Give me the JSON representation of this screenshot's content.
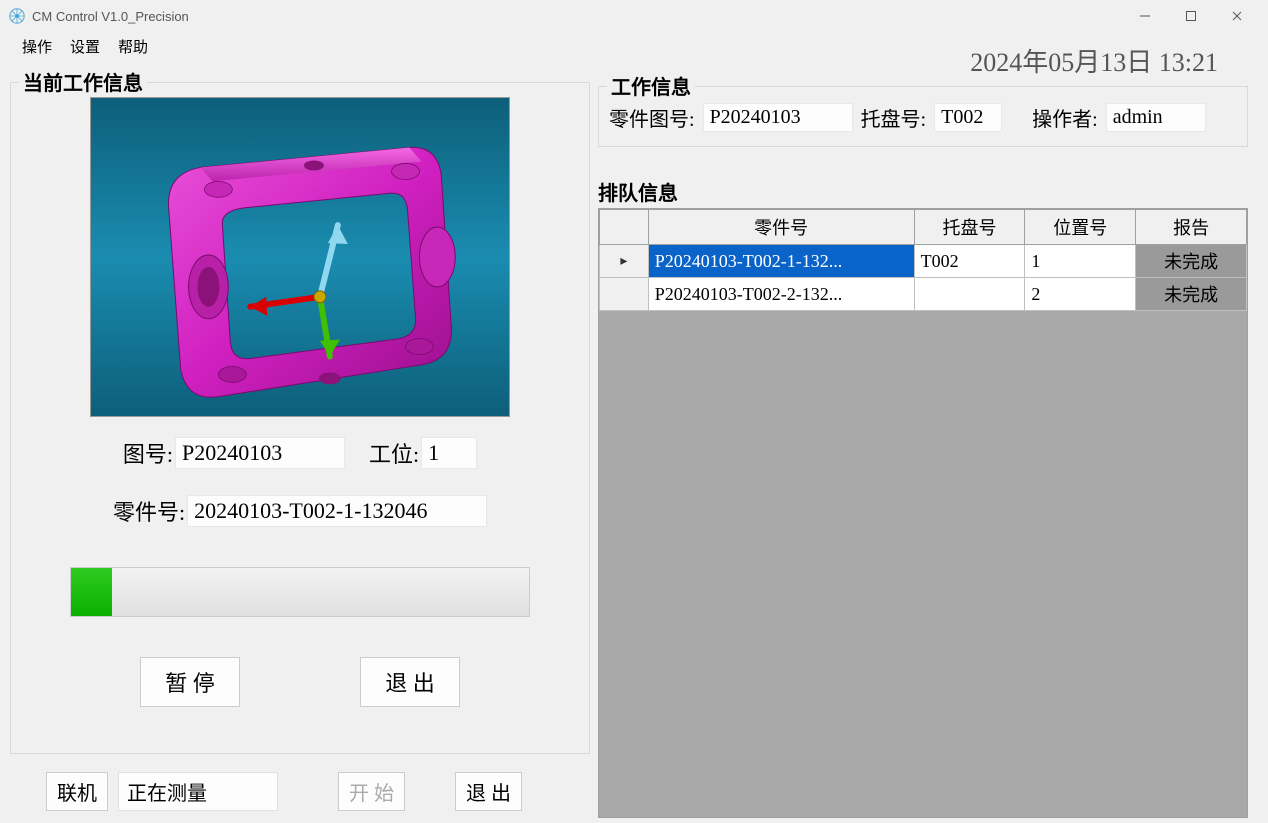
{
  "window": {
    "title": "CM Control V1.0_Precision"
  },
  "menu": {
    "operate": "操作",
    "settings": "设置",
    "help": "帮助"
  },
  "datetime": "2024年05月13日 13:21",
  "current_work": {
    "group_title": "当前工作信息",
    "drawing_label": "图号:",
    "drawing_value": "P20240103",
    "station_label": "工位:",
    "station_value": "1",
    "part_label": "零件号:",
    "part_value": "20240103-T002-1-132046",
    "progress_percent": 9,
    "pause_btn": "暂 停",
    "exit_btn": "退 出"
  },
  "bottom": {
    "connect_btn": "联机",
    "status": "正在测量",
    "start_btn": "开 始",
    "exit_btn": "退 出"
  },
  "work_info": {
    "group_title": "工作信息",
    "drawing_label": "零件图号:",
    "drawing_value": "P20240103",
    "tray_label": "托盘号:",
    "tray_value": "T002",
    "operator_label": "操作者:",
    "operator_value": "admin"
  },
  "queue": {
    "group_title": "排队信息",
    "headers": {
      "part": "零件号",
      "tray": "托盘号",
      "pos": "位置号",
      "report": "报告"
    },
    "rows": [
      {
        "part": "P20240103-T002-1-132...",
        "tray": "T002",
        "pos": "1",
        "report": "未完成",
        "selected": true,
        "current": true
      },
      {
        "part": "P20240103-T002-2-132...",
        "tray": "",
        "pos": "2",
        "report": "未完成",
        "selected": false,
        "current": false
      }
    ]
  }
}
